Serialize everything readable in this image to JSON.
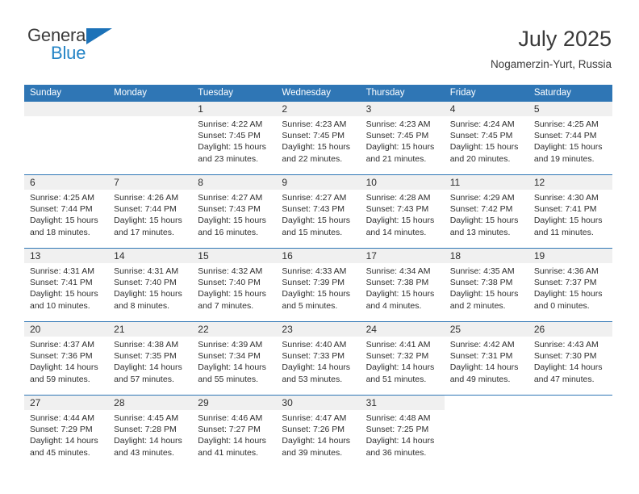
{
  "brand": {
    "name_top": "General",
    "name_bottom": "Blue",
    "accent_color": "#1c72b8",
    "blue_text_color": "#2484c6"
  },
  "header": {
    "title": "July 2025",
    "location": "Nogamerzin-Yurt, Russia"
  },
  "theme": {
    "header_blue": "#2f76b5",
    "day_band_gray": "#f0f0f0",
    "text_color": "#2e2e2e"
  },
  "weekdays": [
    "Sunday",
    "Monday",
    "Tuesday",
    "Wednesday",
    "Thursday",
    "Friday",
    "Saturday"
  ],
  "weeks": [
    [
      {
        "day": "",
        "lines": []
      },
      {
        "day": "",
        "lines": []
      },
      {
        "day": "1",
        "lines": [
          "Sunrise: 4:22 AM",
          "Sunset: 7:45 PM",
          "Daylight: 15 hours",
          "and 23 minutes."
        ]
      },
      {
        "day": "2",
        "lines": [
          "Sunrise: 4:23 AM",
          "Sunset: 7:45 PM",
          "Daylight: 15 hours",
          "and 22 minutes."
        ]
      },
      {
        "day": "3",
        "lines": [
          "Sunrise: 4:23 AM",
          "Sunset: 7:45 PM",
          "Daylight: 15 hours",
          "and 21 minutes."
        ]
      },
      {
        "day": "4",
        "lines": [
          "Sunrise: 4:24 AM",
          "Sunset: 7:45 PM",
          "Daylight: 15 hours",
          "and 20 minutes."
        ]
      },
      {
        "day": "5",
        "lines": [
          "Sunrise: 4:25 AM",
          "Sunset: 7:44 PM",
          "Daylight: 15 hours",
          "and 19 minutes."
        ]
      }
    ],
    [
      {
        "day": "6",
        "lines": [
          "Sunrise: 4:25 AM",
          "Sunset: 7:44 PM",
          "Daylight: 15 hours",
          "and 18 minutes."
        ]
      },
      {
        "day": "7",
        "lines": [
          "Sunrise: 4:26 AM",
          "Sunset: 7:44 PM",
          "Daylight: 15 hours",
          "and 17 minutes."
        ]
      },
      {
        "day": "8",
        "lines": [
          "Sunrise: 4:27 AM",
          "Sunset: 7:43 PM",
          "Daylight: 15 hours",
          "and 16 minutes."
        ]
      },
      {
        "day": "9",
        "lines": [
          "Sunrise: 4:27 AM",
          "Sunset: 7:43 PM",
          "Daylight: 15 hours",
          "and 15 minutes."
        ]
      },
      {
        "day": "10",
        "lines": [
          "Sunrise: 4:28 AM",
          "Sunset: 7:43 PM",
          "Daylight: 15 hours",
          "and 14 minutes."
        ]
      },
      {
        "day": "11",
        "lines": [
          "Sunrise: 4:29 AM",
          "Sunset: 7:42 PM",
          "Daylight: 15 hours",
          "and 13 minutes."
        ]
      },
      {
        "day": "12",
        "lines": [
          "Sunrise: 4:30 AM",
          "Sunset: 7:41 PM",
          "Daylight: 15 hours",
          "and 11 minutes."
        ]
      }
    ],
    [
      {
        "day": "13",
        "lines": [
          "Sunrise: 4:31 AM",
          "Sunset: 7:41 PM",
          "Daylight: 15 hours",
          "and 10 minutes."
        ]
      },
      {
        "day": "14",
        "lines": [
          "Sunrise: 4:31 AM",
          "Sunset: 7:40 PM",
          "Daylight: 15 hours",
          "and 8 minutes."
        ]
      },
      {
        "day": "15",
        "lines": [
          "Sunrise: 4:32 AM",
          "Sunset: 7:40 PM",
          "Daylight: 15 hours",
          "and 7 minutes."
        ]
      },
      {
        "day": "16",
        "lines": [
          "Sunrise: 4:33 AM",
          "Sunset: 7:39 PM",
          "Daylight: 15 hours",
          "and 5 minutes."
        ]
      },
      {
        "day": "17",
        "lines": [
          "Sunrise: 4:34 AM",
          "Sunset: 7:38 PM",
          "Daylight: 15 hours",
          "and 4 minutes."
        ]
      },
      {
        "day": "18",
        "lines": [
          "Sunrise: 4:35 AM",
          "Sunset: 7:38 PM",
          "Daylight: 15 hours",
          "and 2 minutes."
        ]
      },
      {
        "day": "19",
        "lines": [
          "Sunrise: 4:36 AM",
          "Sunset: 7:37 PM",
          "Daylight: 15 hours",
          "and 0 minutes."
        ]
      }
    ],
    [
      {
        "day": "20",
        "lines": [
          "Sunrise: 4:37 AM",
          "Sunset: 7:36 PM",
          "Daylight: 14 hours",
          "and 59 minutes."
        ]
      },
      {
        "day": "21",
        "lines": [
          "Sunrise: 4:38 AM",
          "Sunset: 7:35 PM",
          "Daylight: 14 hours",
          "and 57 minutes."
        ]
      },
      {
        "day": "22",
        "lines": [
          "Sunrise: 4:39 AM",
          "Sunset: 7:34 PM",
          "Daylight: 14 hours",
          "and 55 minutes."
        ]
      },
      {
        "day": "23",
        "lines": [
          "Sunrise: 4:40 AM",
          "Sunset: 7:33 PM",
          "Daylight: 14 hours",
          "and 53 minutes."
        ]
      },
      {
        "day": "24",
        "lines": [
          "Sunrise: 4:41 AM",
          "Sunset: 7:32 PM",
          "Daylight: 14 hours",
          "and 51 minutes."
        ]
      },
      {
        "day": "25",
        "lines": [
          "Sunrise: 4:42 AM",
          "Sunset: 7:31 PM",
          "Daylight: 14 hours",
          "and 49 minutes."
        ]
      },
      {
        "day": "26",
        "lines": [
          "Sunrise: 4:43 AM",
          "Sunset: 7:30 PM",
          "Daylight: 14 hours",
          "and 47 minutes."
        ]
      }
    ],
    [
      {
        "day": "27",
        "lines": [
          "Sunrise: 4:44 AM",
          "Sunset: 7:29 PM",
          "Daylight: 14 hours",
          "and 45 minutes."
        ]
      },
      {
        "day": "28",
        "lines": [
          "Sunrise: 4:45 AM",
          "Sunset: 7:28 PM",
          "Daylight: 14 hours",
          "and 43 minutes."
        ]
      },
      {
        "day": "29",
        "lines": [
          "Sunrise: 4:46 AM",
          "Sunset: 7:27 PM",
          "Daylight: 14 hours",
          "and 41 minutes."
        ]
      },
      {
        "day": "30",
        "lines": [
          "Sunrise: 4:47 AM",
          "Sunset: 7:26 PM",
          "Daylight: 14 hours",
          "and 39 minutes."
        ]
      },
      {
        "day": "31",
        "lines": [
          "Sunrise: 4:48 AM",
          "Sunset: 7:25 PM",
          "Daylight: 14 hours",
          "and 36 minutes."
        ]
      },
      {
        "day": "",
        "lines": []
      },
      {
        "day": "",
        "lines": []
      }
    ]
  ]
}
